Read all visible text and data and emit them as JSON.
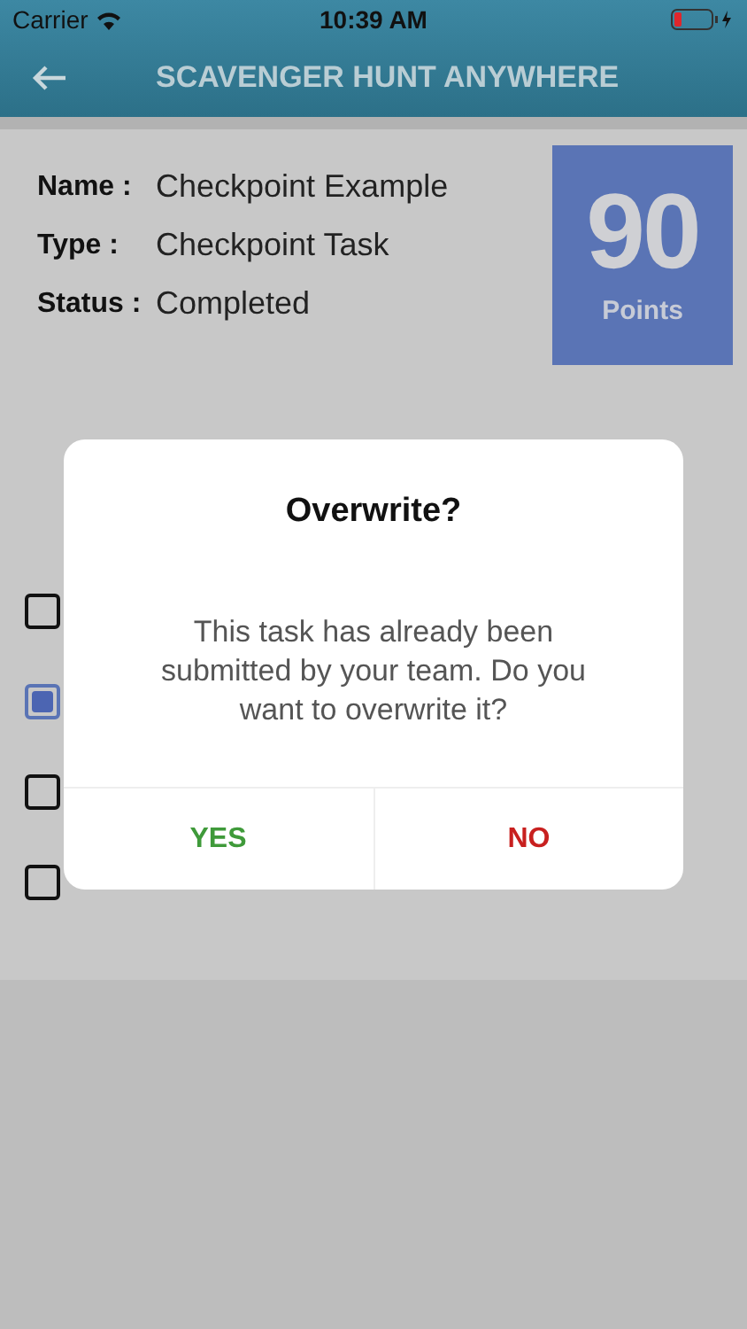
{
  "status_bar": {
    "carrier": "Carrier",
    "time": "10:39 AM"
  },
  "header": {
    "title": "SCAVENGER HUNT ANYWHERE"
  },
  "task": {
    "fields": [
      {
        "label": "Name :",
        "value": "Checkpoint Example"
      },
      {
        "label": "Type :",
        "value": "Checkpoint Task"
      },
      {
        "label": "Status :",
        "value": "Completed"
      }
    ],
    "points": {
      "value": "90",
      "label": "Points"
    }
  },
  "options": [
    {
      "checked": false
    },
    {
      "checked": true
    },
    {
      "checked": false
    },
    {
      "checked": false
    }
  ],
  "dialog": {
    "title": "Overwrite?",
    "message": "This task has already been submitted by your team. Do you want to overwrite it?",
    "buttons": [
      {
        "label": "YES",
        "kind": "confirm"
      },
      {
        "label": "NO",
        "kind": "cancel"
      }
    ]
  }
}
